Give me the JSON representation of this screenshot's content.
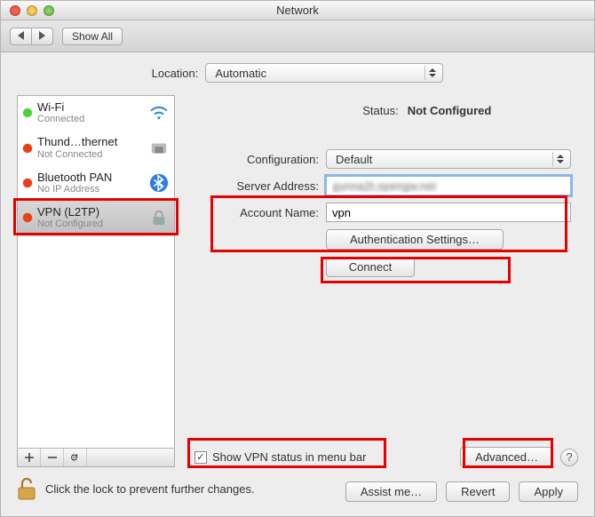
{
  "window": {
    "title": "Network"
  },
  "toolbar": {
    "show_all": "Show All"
  },
  "location": {
    "label": "Location:",
    "value": "Automatic"
  },
  "services": [
    {
      "name": "Wi-Fi",
      "sub": "Connected",
      "status_color": "green",
      "icon": "wifi"
    },
    {
      "name": "Thund…thernet",
      "sub": "Not Connected",
      "status_color": "red",
      "icon": "ethernet"
    },
    {
      "name": "Bluetooth PAN",
      "sub": "No IP Address",
      "status_color": "red",
      "icon": "bluetooth"
    },
    {
      "name": "VPN (L2TP)",
      "sub": "Not Configured",
      "status_color": "red",
      "icon": "lock"
    }
  ],
  "status": {
    "label": "Status:",
    "value": "Not Configured"
  },
  "fields": {
    "configuration": {
      "label": "Configuration:",
      "value": "Default"
    },
    "server_address": {
      "label": "Server Address:",
      "value": "gunna2t.opengw.net"
    },
    "account_name": {
      "label": "Account Name:",
      "value": "vpn"
    }
  },
  "buttons": {
    "auth_settings": "Authentication Settings…",
    "connect": "Connect",
    "advanced": "Advanced…",
    "assist": "Assist me…",
    "revert": "Revert",
    "apply": "Apply"
  },
  "checkbox": {
    "label": "Show VPN status in menu bar",
    "checked": true
  },
  "lock": {
    "text": "Click the lock to prevent further changes."
  }
}
